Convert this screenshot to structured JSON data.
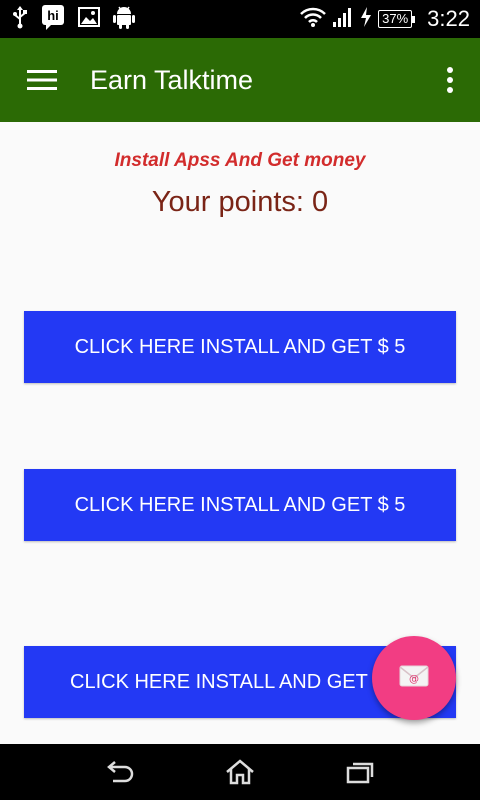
{
  "status_bar": {
    "time": "3:22",
    "battery_level": "37%",
    "notification_icons": [
      "usb-icon",
      "hi-app-icon",
      "image-icon",
      "android-icon"
    ],
    "system_icons": [
      "wifi-icon",
      "signal-icon",
      "charging-icon",
      "battery-icon"
    ]
  },
  "app_bar": {
    "title": "Earn Talktime",
    "menu_icon": "hamburger-menu-icon",
    "overflow_icon": "more-vertical-icon",
    "color": "#2b6a05"
  },
  "main": {
    "tagline": "Install Apss And Get money",
    "points_text": "Your points: 0",
    "buttons": [
      {
        "label": "CLICK HERE INSTALL AND GET $ 5"
      },
      {
        "label": "CLICK HERE INSTALL AND GET $ 5"
      },
      {
        "label": "CLICK HERE INSTALL AND GET $ 5"
      }
    ],
    "button_color": "#2339f4",
    "tagline_color": "#d22c2c",
    "points_color": "#7a2416"
  },
  "fab": {
    "icon": "email-icon",
    "color": "#f23d83"
  },
  "nav_bar": {
    "icons": [
      "back-icon",
      "home-icon",
      "recent-apps-icon"
    ]
  }
}
